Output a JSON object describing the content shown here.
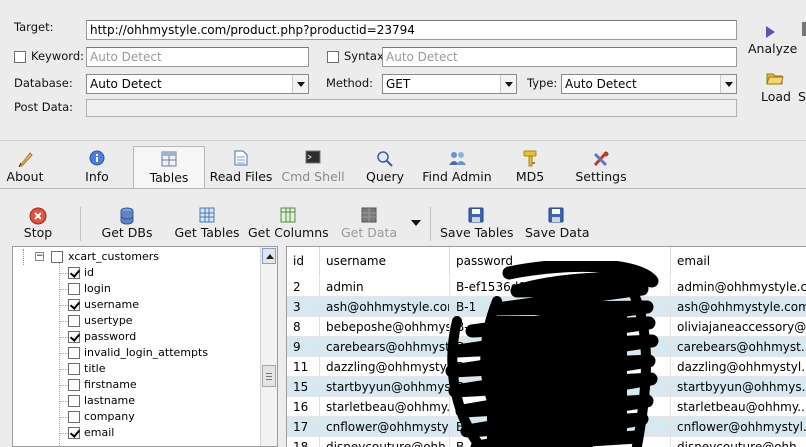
{
  "form": {
    "target_label": "Target:",
    "target_value": "http://ohhmystyle.com/product.php?productid=23794",
    "keyword_label": "Keyword:",
    "keyword_placeholder": "Auto Detect",
    "syntax_label": "Syntax:",
    "syntax_placeholder": "Auto Detect",
    "database_label": "Database:",
    "database_value": "Auto Detect",
    "method_label": "Method:",
    "method_value": "GET",
    "type_label": "Type:",
    "type_value": "Auto Detect",
    "post_data_label": "Post Data:"
  },
  "side_buttons": {
    "analyze": "Analyze",
    "load": "Load",
    "save_partial": "S"
  },
  "tabs": [
    {
      "label": "About",
      "icon": "quill-pen-icon"
    },
    {
      "label": "Info",
      "icon": "info-icon"
    },
    {
      "label": "Tables",
      "icon": "table-icon",
      "selected": true
    },
    {
      "label": "Read Files",
      "icon": "document-icon"
    },
    {
      "label": "Cmd Shell",
      "icon": "terminal-icon",
      "disabled": true
    },
    {
      "label": "Query",
      "icon": "query-icon"
    },
    {
      "label": "Find Admin",
      "icon": "admin-user-icon"
    },
    {
      "label": "MD5",
      "icon": "key-icon"
    },
    {
      "label": "Settings",
      "icon": "tools-icon"
    }
  ],
  "toolbar": {
    "stop": "Stop",
    "get_dbs": "Get DBs",
    "get_tables": "Get Tables",
    "get_columns": "Get Columns",
    "get_data": "Get Data",
    "save_tables": "Save Tables",
    "save_data": "Save Data"
  },
  "tree": {
    "table_name": "xcart_customers",
    "columns": [
      {
        "name": "id",
        "checked": true
      },
      {
        "name": "login",
        "checked": false
      },
      {
        "name": "username",
        "checked": true
      },
      {
        "name": "usertype",
        "checked": false
      },
      {
        "name": "password",
        "checked": true
      },
      {
        "name": "invalid_login_attempts",
        "checked": false
      },
      {
        "name": "title",
        "checked": false
      },
      {
        "name": "firstname",
        "checked": false
      },
      {
        "name": "lastname",
        "checked": false
      },
      {
        "name": "company",
        "checked": false
      },
      {
        "name": "email",
        "checked": true
      }
    ]
  },
  "grid": {
    "headers": [
      "id",
      "username",
      "password",
      "email"
    ],
    "rows": [
      [
        "2",
        "admin",
        "B-ef1536d09d43e6a7dd8c3",
        "admin@ohhmystyle.com"
      ],
      [
        "3",
        "ash@ohhmystyle.com",
        "B-1",
        "ash@ohhmystyle.com"
      ],
      [
        "8",
        "bebeposhe@ohhmyst...",
        "B-",
        "oliviajaneaccessory@..."
      ],
      [
        "9",
        "carebears@ohhmyst...",
        "B-",
        "carebears@ohhmyst..."
      ],
      [
        "11",
        "dazzling@ohhmystyle...",
        "B-",
        "dazzling@ohhmystyl..."
      ],
      [
        "15",
        "startbyyun@ohhmys...",
        "B-",
        "startbyyun@ohhmys..."
      ],
      [
        "16",
        "starletbeau@ohhmy...",
        "B-",
        "starletbeau@ohhmy..."
      ],
      [
        "17",
        "cnflower@ohhmystyl...",
        "B-",
        "cnflower@ohhmystyl..."
      ],
      [
        "18",
        "disneycouture@ohh...",
        "B-",
        "disneycouture@ohh..."
      ]
    ]
  },
  "colors": {
    "selected_row": "#d8e8f0",
    "redaction": "#000000"
  }
}
